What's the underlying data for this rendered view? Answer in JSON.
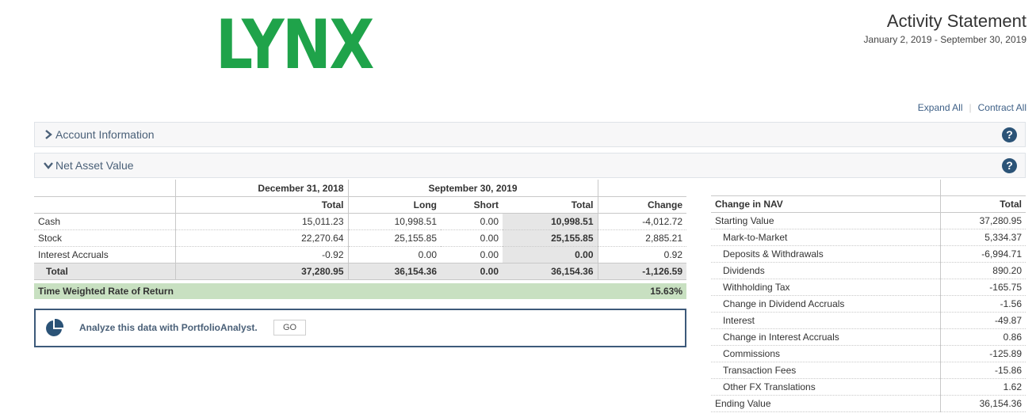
{
  "header": {
    "logo": "LYNX",
    "title": "Activity Statement",
    "period": "January 2, 2019 - September 30, 2019",
    "expand_all": "Expand All",
    "contract_all": "Contract All"
  },
  "sections": {
    "account_information": "Account Information",
    "net_asset_value": "Net Asset Value",
    "help_glyph": "?"
  },
  "nav_table": {
    "group_headers": [
      "December 31, 2018",
      "September 30, 2019"
    ],
    "columns": [
      "Total",
      "Long",
      "Short",
      "Total",
      "Change"
    ],
    "rows": [
      {
        "label": "Cash",
        "prior_total": "15,011.23",
        "long": "10,998.51",
        "short": "0.00",
        "total": "10,998.51",
        "change": "-4,012.72"
      },
      {
        "label": "Stock",
        "prior_total": "22,270.64",
        "long": "25,155.85",
        "short": "0.00",
        "total": "25,155.85",
        "change": "2,885.21"
      },
      {
        "label": "Interest Accruals",
        "prior_total": "-0.92",
        "long": "0.00",
        "short": "0.00",
        "total": "0.00",
        "change": "0.92"
      }
    ],
    "total_row": {
      "label": "Total",
      "prior_total": "37,280.95",
      "long": "36,154.36",
      "short": "0.00",
      "total": "36,154.36",
      "change": "-1,126.59"
    }
  },
  "twr": {
    "label": "Time Weighted Rate of Return",
    "value": "15.63%"
  },
  "portfolio_analyst": {
    "text": "Analyze this data with PortfolioAnalyst.",
    "button": "GO"
  },
  "change_in_nav": {
    "header": "Change in NAV",
    "total_header": "Total",
    "rows": [
      {
        "label": "Starting Value",
        "value": "37,280.95"
      },
      {
        "label": "Mark-to-Market",
        "value": "5,334.37"
      },
      {
        "label": "Deposits & Withdrawals",
        "value": "-6,994.71"
      },
      {
        "label": "Dividends",
        "value": "890.20"
      },
      {
        "label": "Withholding Tax",
        "value": "-165.75"
      },
      {
        "label": "Change in Dividend Accruals",
        "value": "-1.56"
      },
      {
        "label": "Interest",
        "value": "-49.87"
      },
      {
        "label": "Change in Interest Accruals",
        "value": "0.86"
      },
      {
        "label": "Commissions",
        "value": "-125.89"
      },
      {
        "label": "Transaction Fees",
        "value": "-15.86"
      },
      {
        "label": "Other FX Translations",
        "value": "1.62"
      },
      {
        "label": "Ending Value",
        "value": "36,154.36"
      }
    ]
  }
}
